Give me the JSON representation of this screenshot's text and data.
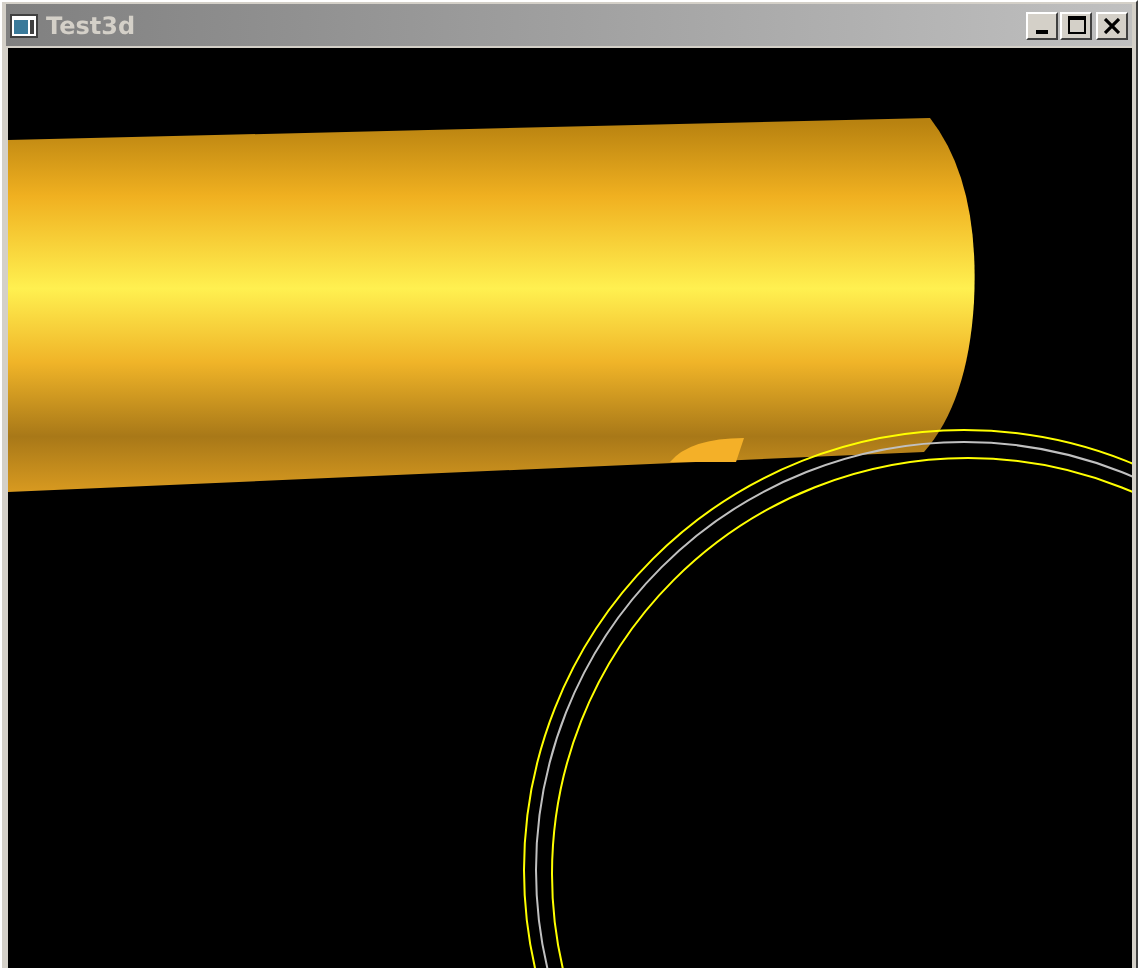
{
  "window": {
    "title": "Test3d"
  }
}
